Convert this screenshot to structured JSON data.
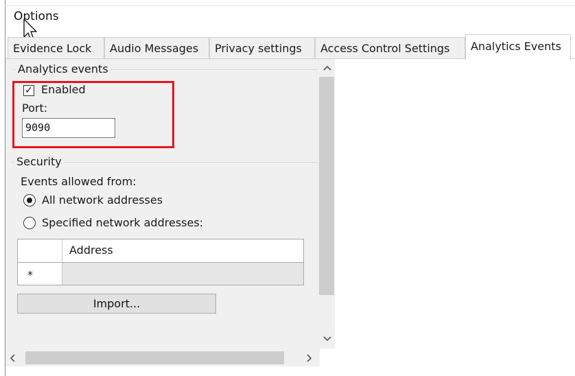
{
  "window": {
    "title": "Options"
  },
  "tabs": [
    {
      "label": "Evidence Lock",
      "active": false
    },
    {
      "label": "Audio Messages",
      "active": false
    },
    {
      "label": "Privacy settings",
      "active": false
    },
    {
      "label": "Access Control Settings",
      "active": false
    },
    {
      "label": "Analytics Events",
      "active": true
    }
  ],
  "analytics_group": {
    "title": "Analytics events",
    "enabled_label": "Enabled",
    "enabled_checked": true,
    "check_glyph": "✓",
    "port_label": "Port:",
    "port_value": "9090"
  },
  "security_group": {
    "title": "Security",
    "events_allowed_label": "Events allowed from:",
    "options": [
      {
        "label": "All network addresses",
        "selected": true
      },
      {
        "label": "Specified network addresses:",
        "selected": false
      }
    ],
    "table": {
      "column_header": "Address",
      "new_row_marker": "*"
    },
    "import_button": "Import..."
  },
  "scrollbars": {
    "up": "^",
    "down": "v",
    "left": "<",
    "right": ">"
  },
  "colors": {
    "highlight": "#e8141c",
    "panel_bg": "#f0f0f0",
    "scroll_thumb": "#cdcdcd"
  },
  "icons": {
    "cursor": "mouse-pointer-icon",
    "checkbox": "checkmark-icon",
    "radio": "radio-dot-icon"
  }
}
